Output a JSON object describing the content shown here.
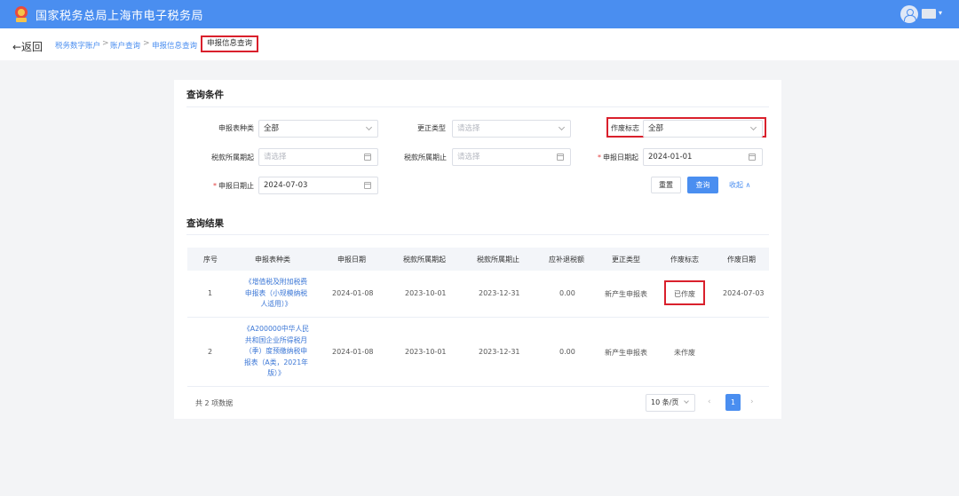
{
  "header": {
    "title": "国家税务总局上海市电子税务局",
    "logo_icon": "tax-emblem-icon",
    "avatar_icon": "user-avatar-icon"
  },
  "breadcrumb": {
    "back_label": "←返回",
    "items": [
      "税务数字账户",
      "账户查询",
      "申报信息查询"
    ],
    "current": "申报信息查询",
    "separator": ">"
  },
  "query": {
    "title": "查询条件",
    "fields": {
      "form_type": {
        "label": "申报表种类",
        "value": "全部"
      },
      "correction_type": {
        "label": "更正类型",
        "placeholder": "请选择"
      },
      "void_flag": {
        "label": "作废标志",
        "value": "全部"
      },
      "period_start": {
        "label": "税款所属期起",
        "placeholder": "请选择"
      },
      "period_end": {
        "label": "税款所属期止",
        "placeholder": "请选择"
      },
      "decl_date_start": {
        "label": "申报日期起",
        "value": "2024-01-01",
        "required_mark": "*"
      },
      "decl_date_end": {
        "label": "申报日期止",
        "value": "2024-07-03",
        "required_mark": "*"
      }
    },
    "reset_label": "重置",
    "query_label": "查询",
    "collapse_label": "收起 ∧"
  },
  "results": {
    "title": "查询结果",
    "columns": [
      "序号",
      "申报表种类",
      "申报日期",
      "税款所属期起",
      "税款所属期止",
      "应补退税额",
      "更正类型",
      "作废标志",
      "作废日期"
    ],
    "rows": [
      {
        "index": "1",
        "form_lines": [
          "《增值税及附加税费",
          "申报表（小规模纳税",
          "人适用）》"
        ],
        "decl_date": "2024-01-08",
        "period_start": "2023-10-01",
        "period_end": "2023-12-31",
        "amount": "0.00",
        "correction_type": "新产生申报表",
        "void_flag": "已作废",
        "void_date": "2024-07-03"
      },
      {
        "index": "2",
        "form_lines": [
          "《A200000中华人民",
          "共和国企业所得税月",
          "（季）度预缴纳税申",
          "报表（A类，2021年",
          "版）》"
        ],
        "decl_date": "2024-01-08",
        "period_start": "2023-10-01",
        "period_end": "2023-12-31",
        "amount": "0.00",
        "correction_type": "新产生申报表",
        "void_flag": "未作废",
        "void_date": ""
      }
    ],
    "total_label": "共 2 项数据",
    "page_size": "10 条/页",
    "current_page": "1",
    "prev": "‹",
    "next": "›"
  },
  "colors": {
    "brand": "#4a8ef0",
    "highlight": "#d9202c",
    "link": "#3a76d6"
  }
}
